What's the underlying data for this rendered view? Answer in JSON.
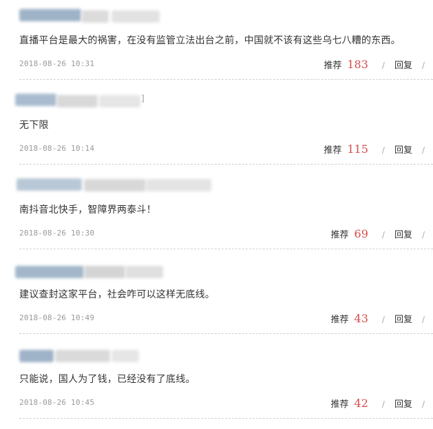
{
  "comments": [
    {
      "text": "直播平台是最大的祸害，在没有监管立法出台之前，中国就不该有这些乌七八糟的东西。",
      "time": "2018-08-26 10:31",
      "recommend_label": "推荐",
      "recommend_count": "183",
      "reply_label": "回复",
      "separator": "/"
    },
    {
      "text": "无下限",
      "time": "2018-08-26 10:14",
      "recommend_label": "推荐",
      "recommend_count": "115",
      "reply_label": "回复",
      "separator": "/"
    },
    {
      "text": "南抖音北快手，智障界两泰斗！",
      "time": "2018-08-26 10:30",
      "recommend_label": "推荐",
      "recommend_count": "69",
      "reply_label": "回复",
      "separator": "/"
    },
    {
      "text": "建议查封这家平台，社会咋可以这样无底线。",
      "time": "2018-08-26 10:49",
      "recommend_label": "推荐",
      "recommend_count": "43",
      "reply_label": "回复",
      "separator": "/"
    },
    {
      "text": "只能说，国人为了钱，已经没有了底线。",
      "time": "2018-08-26 10:45",
      "recommend_label": "推荐",
      "recommend_count": "42",
      "reply_label": "回复",
      "separator": "/"
    }
  ],
  "colors": {
    "text": "#333333",
    "timestamp": "#999999",
    "count": "#d84b4b",
    "divider": "#cfcfcf",
    "blur_blue": "#9db4cc",
    "blur_gray": "#d6d6d6"
  }
}
